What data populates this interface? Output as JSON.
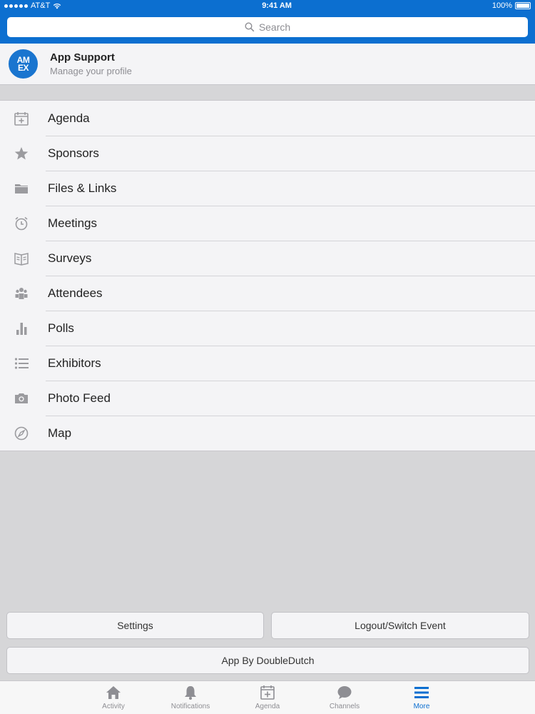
{
  "status_bar": {
    "carrier": "AT&T",
    "time": "9:41 AM",
    "battery": "100%"
  },
  "search": {
    "placeholder": "Search"
  },
  "profile": {
    "logo_text_top": "AM",
    "logo_text_bottom": "EX",
    "name": "App Support",
    "subtitle": "Manage your profile"
  },
  "menu": {
    "items": [
      {
        "label": "Agenda",
        "icon": "calendar-icon"
      },
      {
        "label": "Sponsors",
        "icon": "star-icon"
      },
      {
        "label": "Files & Links",
        "icon": "folder-icon"
      },
      {
        "label": "Meetings",
        "icon": "alarm-clock-icon"
      },
      {
        "label": "Surveys",
        "icon": "book-icon"
      },
      {
        "label": "Attendees",
        "icon": "people-icon"
      },
      {
        "label": "Polls",
        "icon": "bar-chart-icon"
      },
      {
        "label": "Exhibitors",
        "icon": "list-icon"
      },
      {
        "label": "Photo Feed",
        "icon": "camera-icon"
      },
      {
        "label": "Map",
        "icon": "compass-icon"
      }
    ]
  },
  "buttons": {
    "settings": "Settings",
    "logout": "Logout/Switch Event",
    "app_by": "App By DoubleDutch"
  },
  "tabbar": {
    "tabs": [
      {
        "label": "Activity",
        "icon": "home-icon"
      },
      {
        "label": "Notifications",
        "icon": "bell-icon"
      },
      {
        "label": "Agenda",
        "icon": "calendar-icon"
      },
      {
        "label": "Channels",
        "icon": "chat-bubble-icon"
      },
      {
        "label": "More",
        "icon": "menu-icon"
      }
    ],
    "active_tab": "More"
  },
  "colors": {
    "brand_blue": "#0c6fd0",
    "background": "#d6d6d8",
    "menu_bg": "#f4f4f6",
    "icon_gray": "#9b9b9f"
  }
}
